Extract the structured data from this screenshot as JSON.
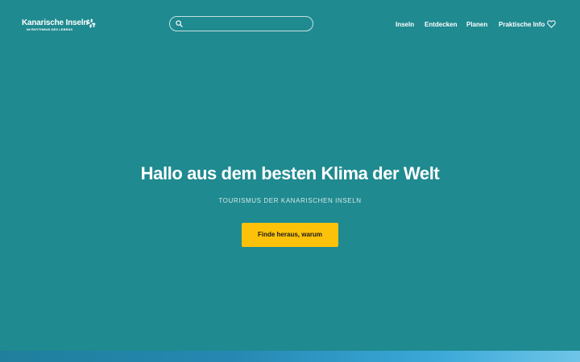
{
  "header": {
    "logo": {
      "title": "Kanarische Inseln",
      "tagline": "IM RHYTHMUS DES LEBENS"
    },
    "search": {
      "value": "",
      "placeholder": "",
      "icon": "search-icon"
    },
    "nav": [
      {
        "label": "Inseln"
      },
      {
        "label": "Entdecken"
      },
      {
        "label": "Planen"
      },
      {
        "label": "Praktische Info"
      }
    ],
    "favorites_icon": "heart-icon"
  },
  "hero": {
    "title": "Hallo aus dem besten Klima der Welt",
    "subtitle": "TOURISMUS DER KANARISCHEN INSELN",
    "cta_label": "Finde heraus, warum"
  },
  "colors": {
    "background": "#1f8a90",
    "cta": "#fcc20a",
    "text": "#ffffff"
  }
}
